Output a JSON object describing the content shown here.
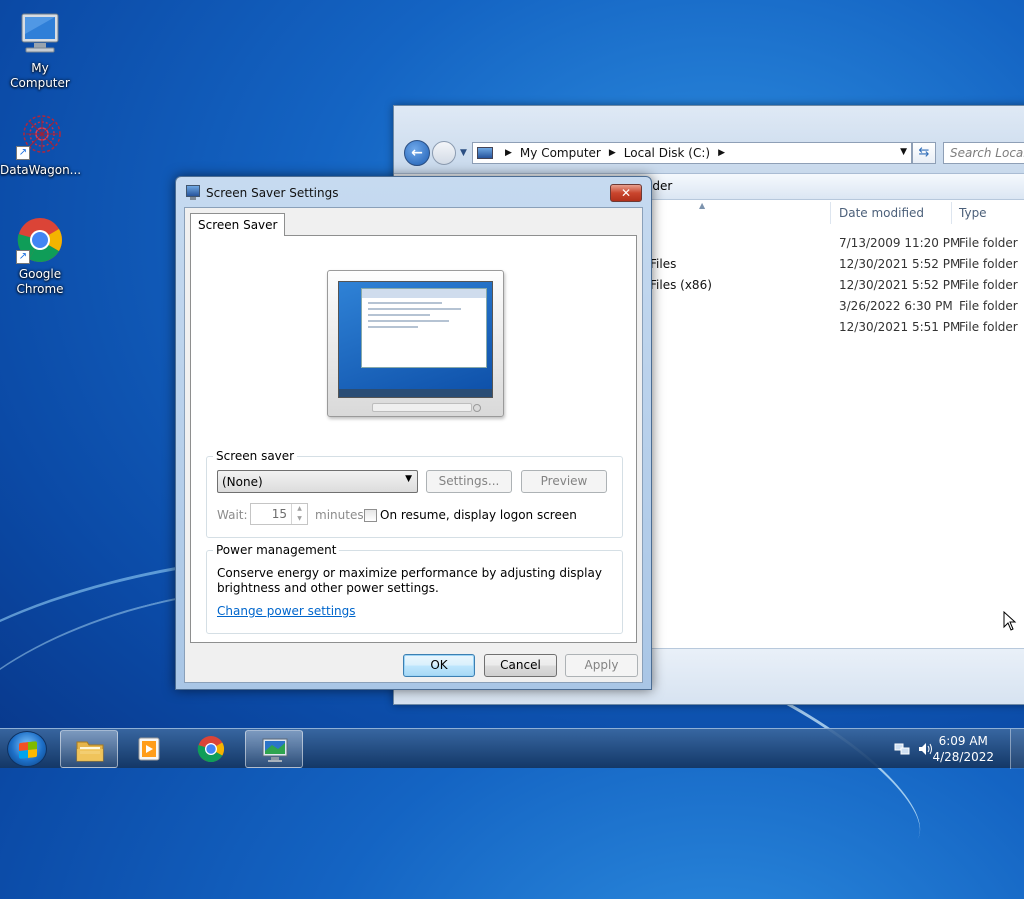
{
  "desktop": {
    "icons": [
      {
        "label": "My Computer",
        "icon": "computer-icon"
      },
      {
        "label": "DataWagon...",
        "icon": "datawagon-icon"
      },
      {
        "label": "Google Chrome",
        "icon": "chrome-icon"
      }
    ]
  },
  "explorer": {
    "breadcrumb": [
      "My Computer",
      "Local Disk (C:)"
    ],
    "search_placeholder": "Search Local D",
    "toolbar_partial": "lder",
    "columns": {
      "date": "Date modified",
      "type": "Type"
    },
    "rows": [
      {
        "name": "",
        "date": "7/13/2009 11:20 PM",
        "type": "File folder"
      },
      {
        "name": "Files",
        "date": "12/30/2021 5:52 PM",
        "type": "File folder"
      },
      {
        "name": "Files (x86)",
        "date": "12/30/2021 5:52 PM",
        "type": "File folder"
      },
      {
        "name": "",
        "date": "3/26/2022 6:30 PM",
        "type": "File folder"
      },
      {
        "name": "",
        "date": "12/30/2021 5:51 PM",
        "type": "File folder"
      }
    ]
  },
  "dialog": {
    "title": "Screen Saver Settings",
    "tab": "Screen Saver",
    "screen_saver": {
      "group_label": "Screen saver",
      "selected": "(None)",
      "settings_button": "Settings...",
      "preview_button": "Preview",
      "wait_label": "Wait:",
      "wait_value": "15",
      "minutes_label": "minutes",
      "resume_label": "On resume, display logon screen",
      "resume_checked": false
    },
    "power": {
      "group_label": "Power management",
      "text": "Conserve energy or maximize performance by adjusting display brightness and other power settings.",
      "link": "Change power settings"
    },
    "buttons": {
      "ok": "OK",
      "cancel": "Cancel",
      "apply": "Apply"
    }
  },
  "taskbar": {
    "apps": [
      {
        "icon": "windows-explorer-icon",
        "active": true
      },
      {
        "icon": "media-player-icon",
        "active": false
      },
      {
        "icon": "chrome-icon",
        "active": false
      },
      {
        "icon": "display-settings-icon",
        "active": true
      }
    ],
    "time": "6:09 AM",
    "date": "4/28/2022"
  }
}
